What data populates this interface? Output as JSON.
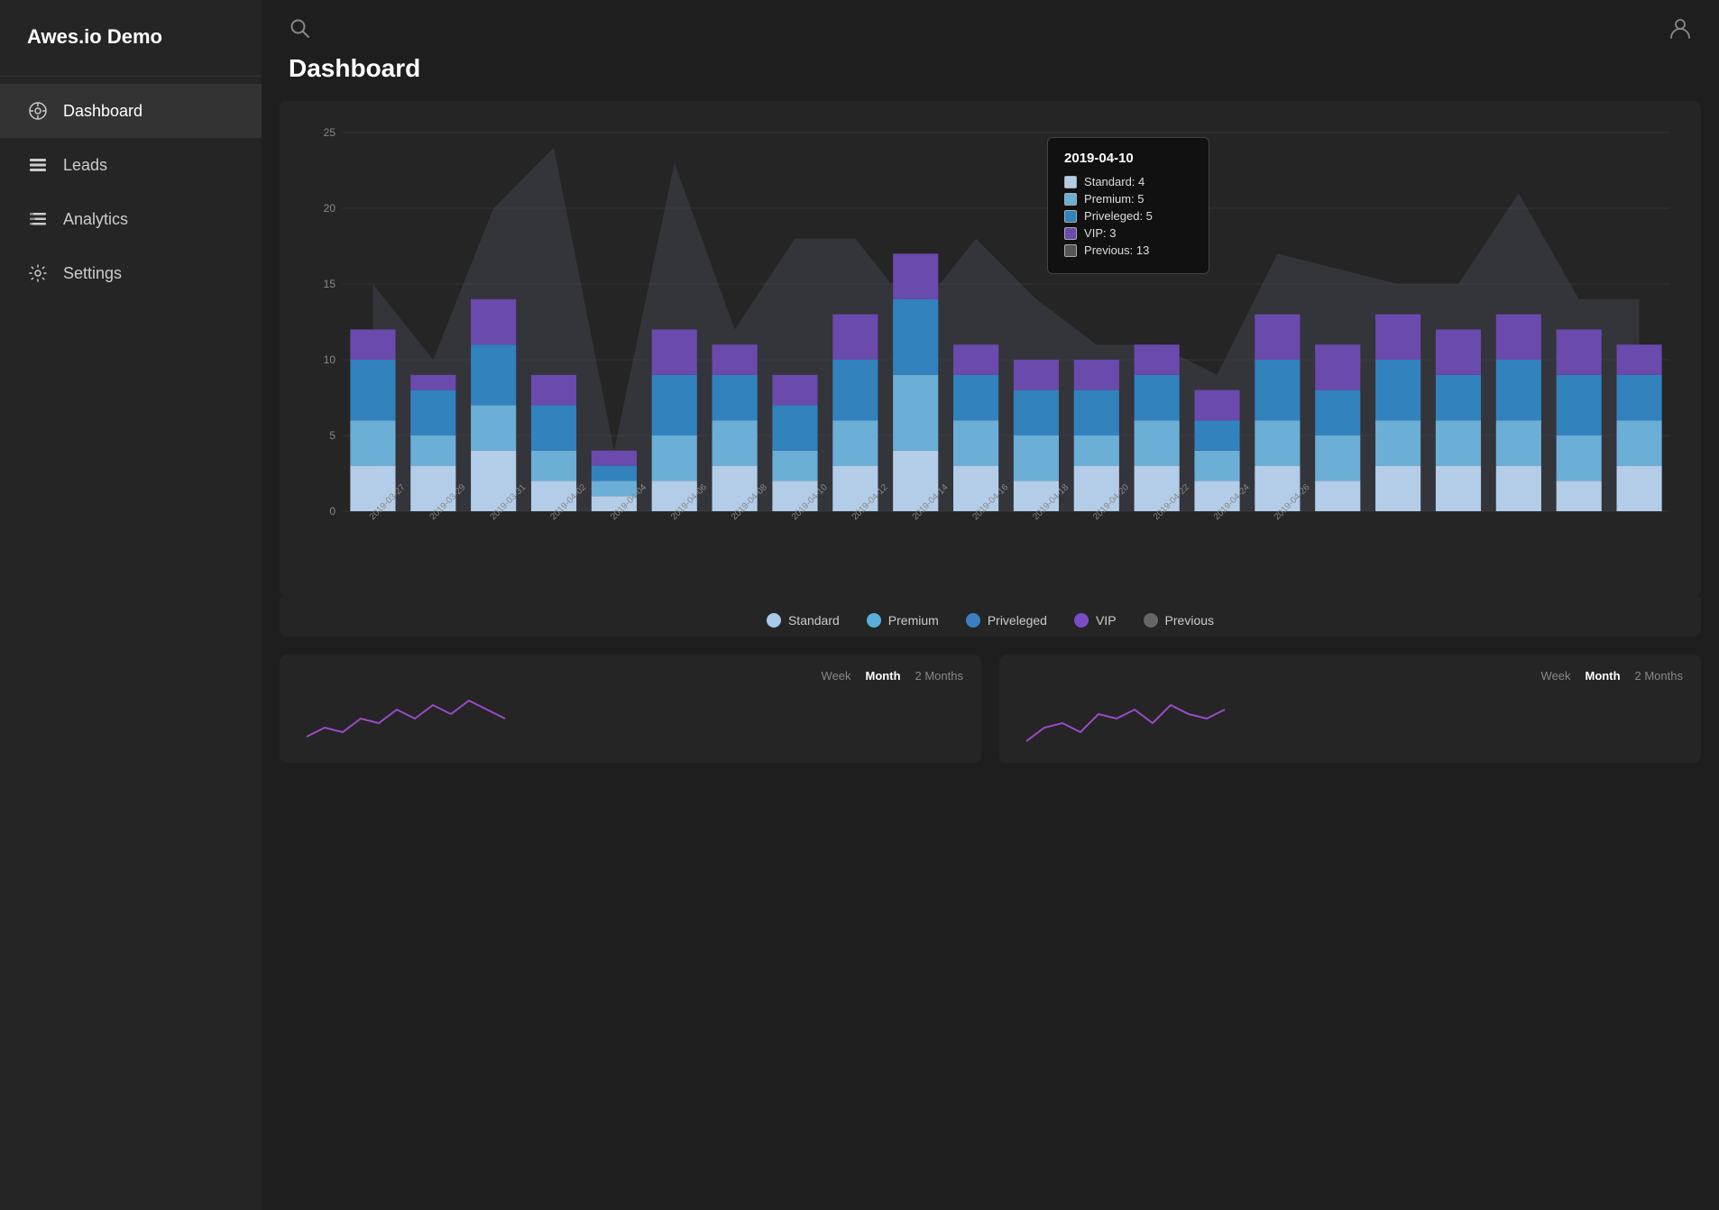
{
  "app": {
    "title": "Awes.io Demo"
  },
  "sidebar": {
    "items": [
      {
        "id": "dashboard",
        "label": "Dashboard",
        "icon": "dashboard-icon",
        "active": true
      },
      {
        "id": "leads",
        "label": "Leads",
        "icon": "leads-icon",
        "active": false
      },
      {
        "id": "analytics",
        "label": "Analytics",
        "icon": "analytics-icon",
        "active": false
      },
      {
        "id": "settings",
        "label": "Settings",
        "icon": "settings-icon",
        "active": false
      }
    ]
  },
  "header": {
    "title": "Dashboard"
  },
  "tooltip": {
    "date": "2019-04-10",
    "rows": [
      {
        "label": "Standard",
        "value": 4,
        "color": "#b3cde8"
      },
      {
        "label": "Premium",
        "value": 5,
        "color": "#6baed6"
      },
      {
        "label": "Priveleged",
        "value": 5,
        "color": "#3182bd"
      },
      {
        "label": "VIP",
        "value": 3,
        "color": "#6a4aad"
      },
      {
        "label": "Previous",
        "value": 13,
        "color": "#555"
      }
    ]
  },
  "legend": {
    "items": [
      {
        "label": "Standard",
        "color": "#aac9e8"
      },
      {
        "label": "Premium",
        "color": "#5aaedb"
      },
      {
        "label": "Priveleged",
        "color": "#3a7fc1"
      },
      {
        "label": "VIP",
        "color": "#7b4bc8"
      },
      {
        "label": "Previous",
        "color": "#666"
      }
    ]
  },
  "chart": {
    "yLabels": [
      "0",
      "5",
      "10",
      "15",
      "20",
      "25"
    ],
    "xLabels": [
      "2019-03-27",
      "2019-03-29",
      "2019-03-31",
      "2019-04-02",
      "2019-04-04",
      "2019-04-06",
      "2019-04-08",
      "2019-04-10",
      "2019-04-12",
      "2019-04-14",
      "2019-04-16",
      "2019-04-18",
      "2019-04-20",
      "2019-04-22",
      "2019-04-24",
      "2019-04-26"
    ],
    "bars": [
      {
        "standard": 3,
        "premium": 3,
        "priveleged": 4,
        "vip": 2,
        "prev": 15
      },
      {
        "standard": 3,
        "premium": 2,
        "priveleged": 3,
        "vip": 1,
        "prev": 10
      },
      {
        "standard": 4,
        "premium": 3,
        "priveleged": 4,
        "vip": 3,
        "prev": 20
      },
      {
        "standard": 2,
        "premium": 2,
        "priveleged": 3,
        "vip": 2,
        "prev": 24
      },
      {
        "standard": 1,
        "premium": 1,
        "priveleged": 1,
        "vip": 1,
        "prev": 4
      },
      {
        "standard": 2,
        "premium": 3,
        "priveleged": 4,
        "vip": 3,
        "prev": 23
      },
      {
        "standard": 3,
        "premium": 3,
        "priveleged": 3,
        "vip": 2,
        "prev": 12
      },
      {
        "standard": 2,
        "premium": 2,
        "priveleged": 3,
        "vip": 2,
        "prev": 18
      },
      {
        "standard": 3,
        "premium": 3,
        "priveleged": 4,
        "vip": 3,
        "prev": 18
      },
      {
        "standard": 4,
        "premium": 5,
        "priveleged": 5,
        "vip": 3,
        "prev": 13
      },
      {
        "standard": 3,
        "premium": 3,
        "priveleged": 3,
        "vip": 2,
        "prev": 18
      },
      {
        "standard": 2,
        "premium": 3,
        "priveleged": 3,
        "vip": 2,
        "prev": 14
      },
      {
        "standard": 3,
        "premium": 2,
        "priveleged": 3,
        "vip": 2,
        "prev": 11
      },
      {
        "standard": 3,
        "premium": 3,
        "priveleged": 3,
        "vip": 2,
        "prev": 11
      },
      {
        "standard": 2,
        "premium": 2,
        "priveleged": 2,
        "vip": 2,
        "prev": 9
      },
      {
        "standard": 3,
        "premium": 3,
        "priveleged": 4,
        "vip": 3,
        "prev": 17
      },
      {
        "standard": 2,
        "premium": 3,
        "priveleged": 3,
        "vip": 3,
        "prev": 16
      },
      {
        "standard": 3,
        "premium": 3,
        "priveleged": 4,
        "vip": 3,
        "prev": 15
      },
      {
        "standard": 3,
        "premium": 3,
        "priveleged": 3,
        "vip": 3,
        "prev": 15
      },
      {
        "standard": 3,
        "premium": 3,
        "priveleged": 4,
        "vip": 3,
        "prev": 21
      },
      {
        "standard": 2,
        "premium": 3,
        "priveleged": 4,
        "vip": 3,
        "prev": 14
      },
      {
        "standard": 3,
        "premium": 3,
        "priveleged": 3,
        "vip": 2,
        "prev": 14
      }
    ],
    "maxValue": 25
  },
  "bottomCards": [
    {
      "tabs": [
        "Week",
        "Month",
        "2 Months"
      ],
      "activeTab": "Month"
    },
    {
      "tabs": [
        "Week",
        "Month",
        "2 Months"
      ],
      "activeTab": "Month"
    }
  ]
}
